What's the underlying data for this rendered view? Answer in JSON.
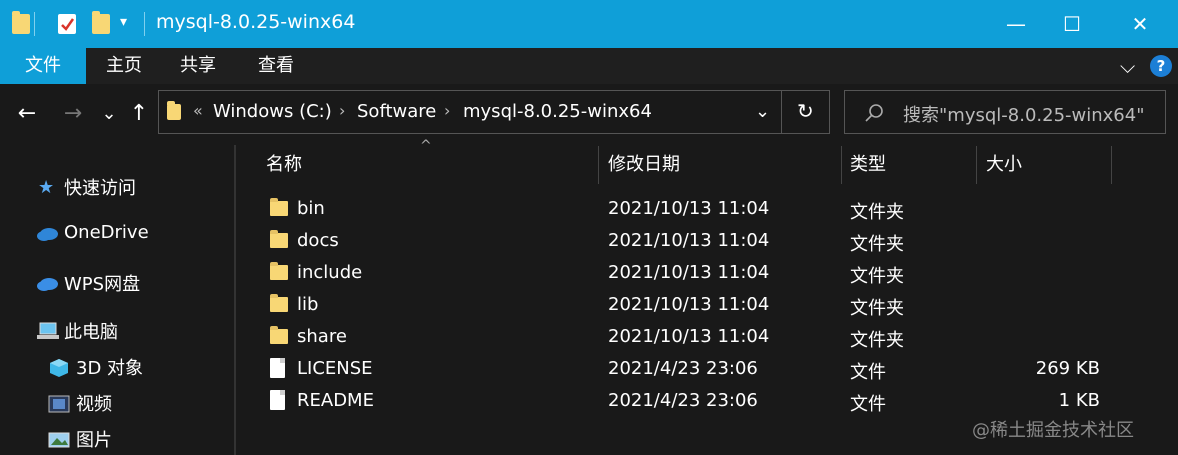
{
  "window": {
    "title": "mysql-8.0.25-winx64",
    "accent": "#0f9fd8",
    "controls": {
      "minimize": "—",
      "maximize": "☐",
      "close": "✕"
    }
  },
  "ribbon": {
    "tabs": [
      "文件",
      "主页",
      "共享",
      "查看"
    ],
    "expand_glyph": "⌵",
    "help_glyph": "?"
  },
  "nav": {
    "back": "←",
    "forward": "→",
    "recent": "⌄",
    "up": "↑",
    "refresh": "↻",
    "address_dropdown": "⌄"
  },
  "address": {
    "overflow": "«",
    "crumbs": [
      "Windows (C:)",
      "Software",
      "mysql-8.0.25-winx64"
    ],
    "separator": "›"
  },
  "search": {
    "placeholder": "搜索\"mysql-8.0.25-winx64\""
  },
  "sidebar": {
    "items": [
      {
        "label": "快速访问",
        "icon": "star-icon"
      },
      {
        "label": "OneDrive",
        "icon": "cloud-icon"
      },
      {
        "label": "WPS网盘",
        "icon": "cloud-icon"
      },
      {
        "label": "此电脑",
        "icon": "computer-icon"
      },
      {
        "label": "3D 对象",
        "icon": "cube-icon"
      },
      {
        "label": "视频",
        "icon": "video-icon"
      },
      {
        "label": "图片",
        "icon": "picture-icon"
      }
    ]
  },
  "columns": {
    "name": "名称",
    "date": "修改日期",
    "type": "类型",
    "size": "大小",
    "sort_glyph": "^"
  },
  "files": [
    {
      "name": "bin",
      "date": "2021/10/13 11:04",
      "type": "文件夹",
      "size": "",
      "icon": "folder-icon"
    },
    {
      "name": "docs",
      "date": "2021/10/13 11:04",
      "type": "文件夹",
      "size": "",
      "icon": "folder-icon"
    },
    {
      "name": "include",
      "date": "2021/10/13 11:04",
      "type": "文件夹",
      "size": "",
      "icon": "folder-icon"
    },
    {
      "name": "lib",
      "date": "2021/10/13 11:04",
      "type": "文件夹",
      "size": "",
      "icon": "folder-icon"
    },
    {
      "name": "share",
      "date": "2021/10/13 11:04",
      "type": "文件夹",
      "size": "",
      "icon": "folder-icon"
    },
    {
      "name": "LICENSE",
      "date": "2021/4/23 23:06",
      "type": "文件",
      "size": "269 KB",
      "icon": "file-icon"
    },
    {
      "name": "README",
      "date": "2021/4/23 23:06",
      "type": "文件",
      "size": "1 KB",
      "icon": "file-icon"
    }
  ],
  "watermark": "@稀土掘金技术社区"
}
